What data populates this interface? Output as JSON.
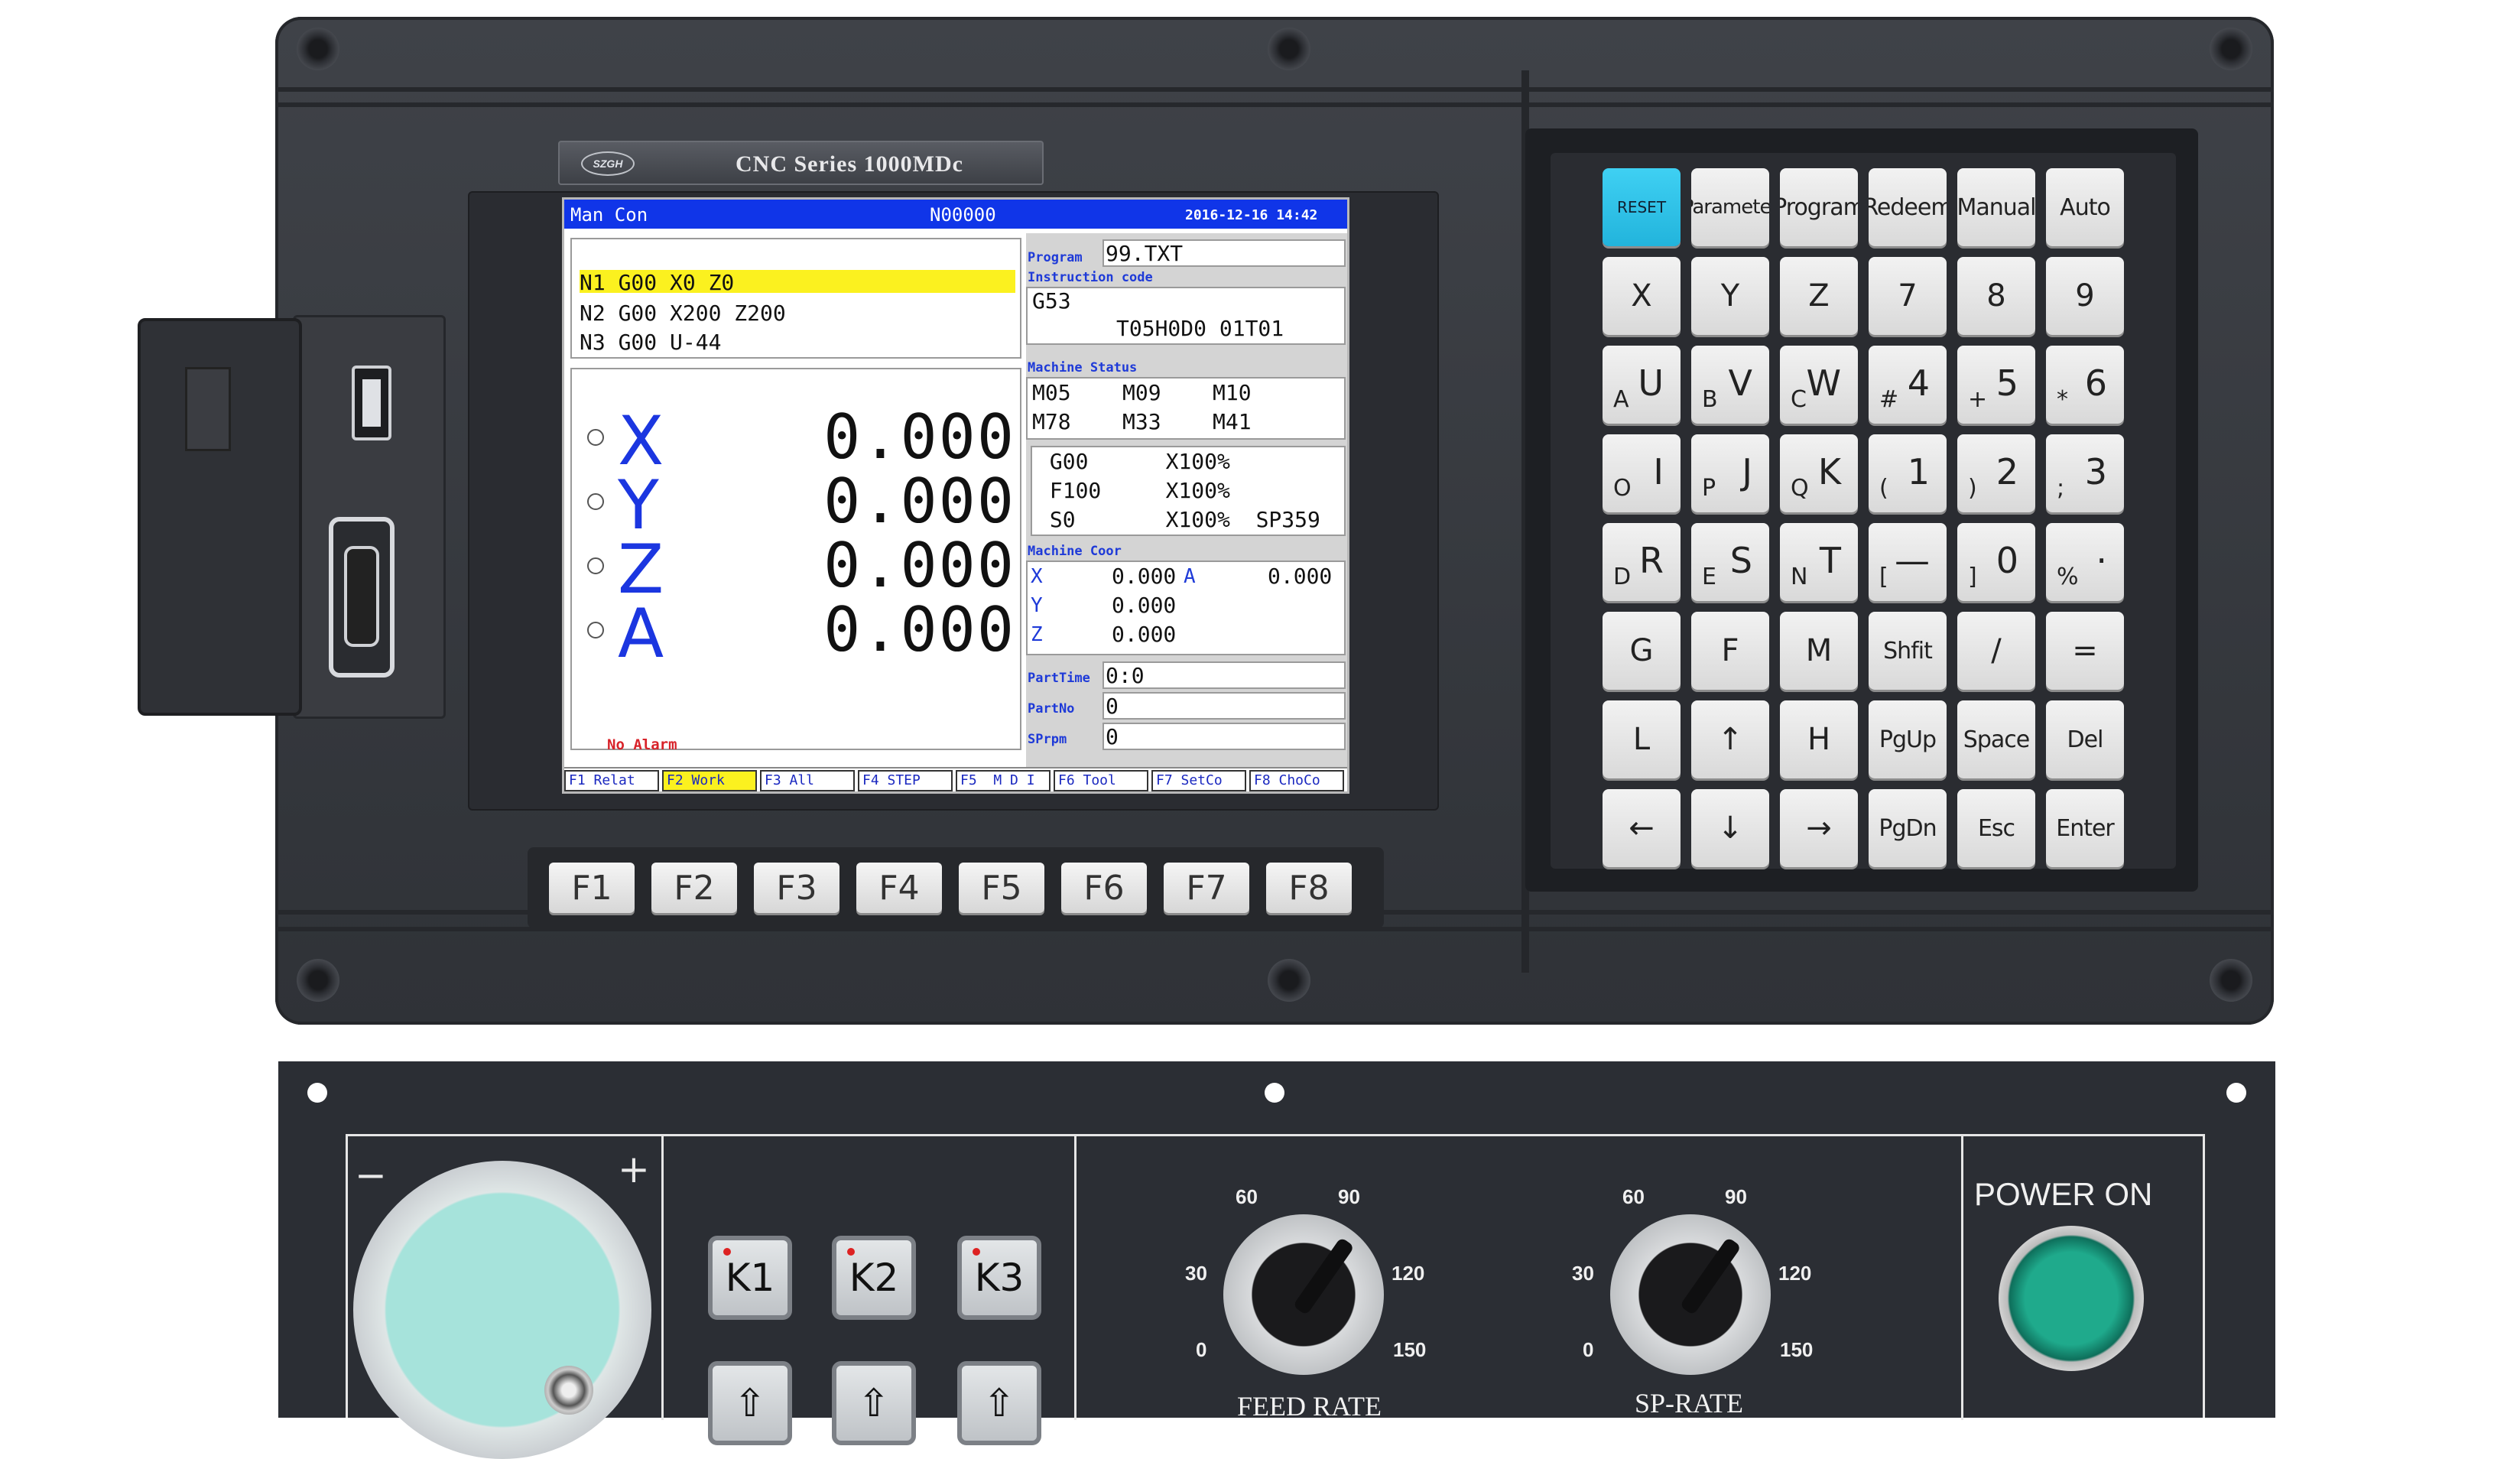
{
  "panel": {
    "model": "CNC Series 1000MDc",
    "brand": "SZGH"
  },
  "lcd": {
    "mode": "Man Con",
    "program_no": "N00000",
    "datetime": "2016-12-16  14:42",
    "code_lines": [
      "N1 G00 X0 Z0",
      "N2 G00 X200 Z200",
      "N3 G00 U-44"
    ],
    "positions": [
      {
        "axis": "X",
        "value": "0.000"
      },
      {
        "axis": "Y",
        "value": "0.000"
      },
      {
        "axis": "Z",
        "value": "0.000"
      },
      {
        "axis": "A",
        "value": "0.000"
      }
    ],
    "alarm": "No Alarm",
    "program_label": "Program",
    "program_value": "99.TXT",
    "instruction_label": "Instruction code",
    "instruction_line1": "G53",
    "instruction_line2": "T05H0D0 01T01",
    "machine_status_label": "Machine Status",
    "status_line1": "M05    M09    M10",
    "status_line2": "M78    M33    M41",
    "feed_line1": " G00      X100%",
    "feed_line2": " F100     X100%",
    "feed_line3": " S0       X100%  SP359",
    "machine_coor_label": "Machine Coor",
    "coor_x_label": "X",
    "coor_x_value": "0.000",
    "coor_a_label": "A",
    "coor_a_value": "0.000",
    "coor_y_label": "Y",
    "coor_y_value": "0.000",
    "coor_z_label": "Z",
    "coor_z_value": "0.000",
    "parttime_label": "PartTime",
    "parttime_value": "0:0",
    "partno_label": "PartNo",
    "partno_value": "0",
    "sprpm_label": "SPrpm",
    "sprpm_value": "0",
    "softkeys": [
      "F1 Relat",
      "F2 Work",
      "F3 All",
      "F4 STEP",
      "F5  M D I",
      "F6 Tool",
      "F7 SetCo",
      "F8 ChoCo"
    ],
    "active_softkey": 1
  },
  "fkeys": [
    "F1",
    "F2",
    "F3",
    "F4",
    "F5",
    "F6",
    "F7",
    "F8"
  ],
  "keypad": {
    "row1": [
      "RESET",
      "Parameter",
      "Program",
      "Redeem",
      "Manual",
      "Auto"
    ],
    "row2": [
      "X",
      "Y",
      "Z",
      "7",
      "8",
      "9"
    ],
    "row3": [
      {
        "main": "U",
        "sub": "A"
      },
      {
        "main": "V",
        "sub": "B"
      },
      {
        "main": "W",
        "sub": "C"
      },
      {
        "main": "4",
        "sub": "#"
      },
      {
        "main": "5",
        "sub": "+"
      },
      {
        "main": "6",
        "sub": "*"
      }
    ],
    "row4": [
      {
        "main": "I",
        "sub": "O"
      },
      {
        "main": "J",
        "sub": "P"
      },
      {
        "main": "K",
        "sub": "Q"
      },
      {
        "main": "1",
        "sub": "("
      },
      {
        "main": "2",
        "sub": ")"
      },
      {
        "main": "3",
        "sub": ";"
      }
    ],
    "row5": [
      {
        "main": "R",
        "sub": "D"
      },
      {
        "main": "S",
        "sub": "E"
      },
      {
        "main": "T",
        "sub": "N"
      },
      {
        "main": "—",
        "sub": "["
      },
      {
        "main": "0",
        "sub": "]"
      },
      {
        "main": "·",
        "sub": "%"
      }
    ],
    "row6": [
      "G",
      "F",
      "M",
      "Shfit",
      "/",
      "="
    ],
    "row7": [
      "L",
      "↑",
      "H",
      "PgUp",
      "Space",
      "Del"
    ],
    "row8": [
      "←",
      "↓",
      "→",
      "PgDn",
      "Esc",
      "Enter"
    ]
  },
  "operator": {
    "k_keys": [
      "K1",
      "K2",
      "K3"
    ],
    "arrow_symbol": "⇧",
    "mpg_minus": "−",
    "mpg_plus": "+",
    "feed_label": "FEED RATE",
    "sp_label": "SP-RATE",
    "dial_ticks": [
      "0",
      "30",
      "60",
      "90",
      "120",
      "150"
    ],
    "power_label": "POWER ON"
  }
}
